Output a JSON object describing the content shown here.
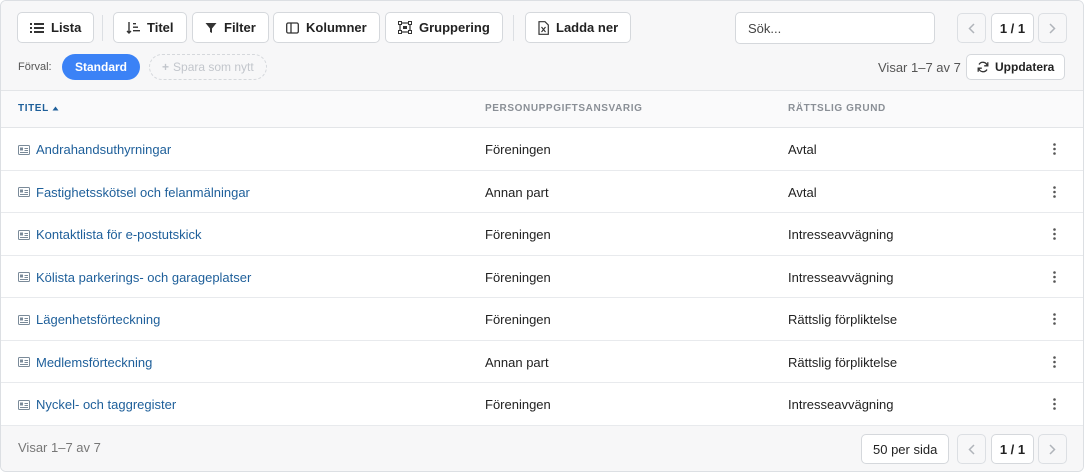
{
  "toolbar": {
    "list_label": "Lista",
    "sort_label": "Titel",
    "filter_label": "Filter",
    "columns_label": "Kolumner",
    "grouping_label": "Gruppering",
    "download_label": "Ladda ner"
  },
  "search": {
    "placeholder": "Sök..."
  },
  "pagination": {
    "indicator": "1 / 1"
  },
  "presets": {
    "label": "Förval:",
    "active": "Standard",
    "save_new": "Spara som nytt"
  },
  "status": {
    "showing": "Visar 1–7 av 7",
    "refresh_label": "Uppdatera"
  },
  "table": {
    "columns": [
      "TITEL",
      "PERSONUPPGIFTSANSVARIG",
      "RÄTTSLIG GRUND"
    ],
    "rows": [
      {
        "title": "Andrahandsuthyrningar",
        "controller": "Föreningen",
        "legal_basis": "Avtal"
      },
      {
        "title": "Fastighetsskötsel och felanmälningar",
        "controller": "Annan part",
        "legal_basis": "Avtal"
      },
      {
        "title": "Kontaktlista för e-postutskick",
        "controller": "Föreningen",
        "legal_basis": "Intresseavvägning"
      },
      {
        "title": "Kölista parkerings- och garageplatser",
        "controller": "Föreningen",
        "legal_basis": "Intresseavvägning"
      },
      {
        "title": "Lägenhetsförteckning",
        "controller": "Föreningen",
        "legal_basis": "Rättslig förpliktelse"
      },
      {
        "title": "Medlemsförteckning",
        "controller": "Annan part",
        "legal_basis": "Rättslig förpliktelse"
      },
      {
        "title": "Nyckel- och taggregister",
        "controller": "Föreningen",
        "legal_basis": "Intresseavvägning"
      }
    ]
  },
  "footer": {
    "showing": "Visar 1–7 av 7",
    "per_page": "50 per sida",
    "indicator": "1 / 1"
  },
  "colors": {
    "accent": "#3b82f6",
    "link": "#1e5f9a",
    "header_bg": "#f7f7f8",
    "border": "#dcdfe3"
  },
  "icons": {
    "list": "list-icon",
    "sort": "sort-icon",
    "filter": "filter-icon",
    "columns": "columns-icon",
    "grouping": "grouping-icon",
    "download": "file-download-icon",
    "prev": "chevron-left-icon",
    "next": "chevron-right-icon",
    "refresh": "refresh-icon",
    "row": "id-card-icon",
    "menu": "kebab-icon"
  }
}
